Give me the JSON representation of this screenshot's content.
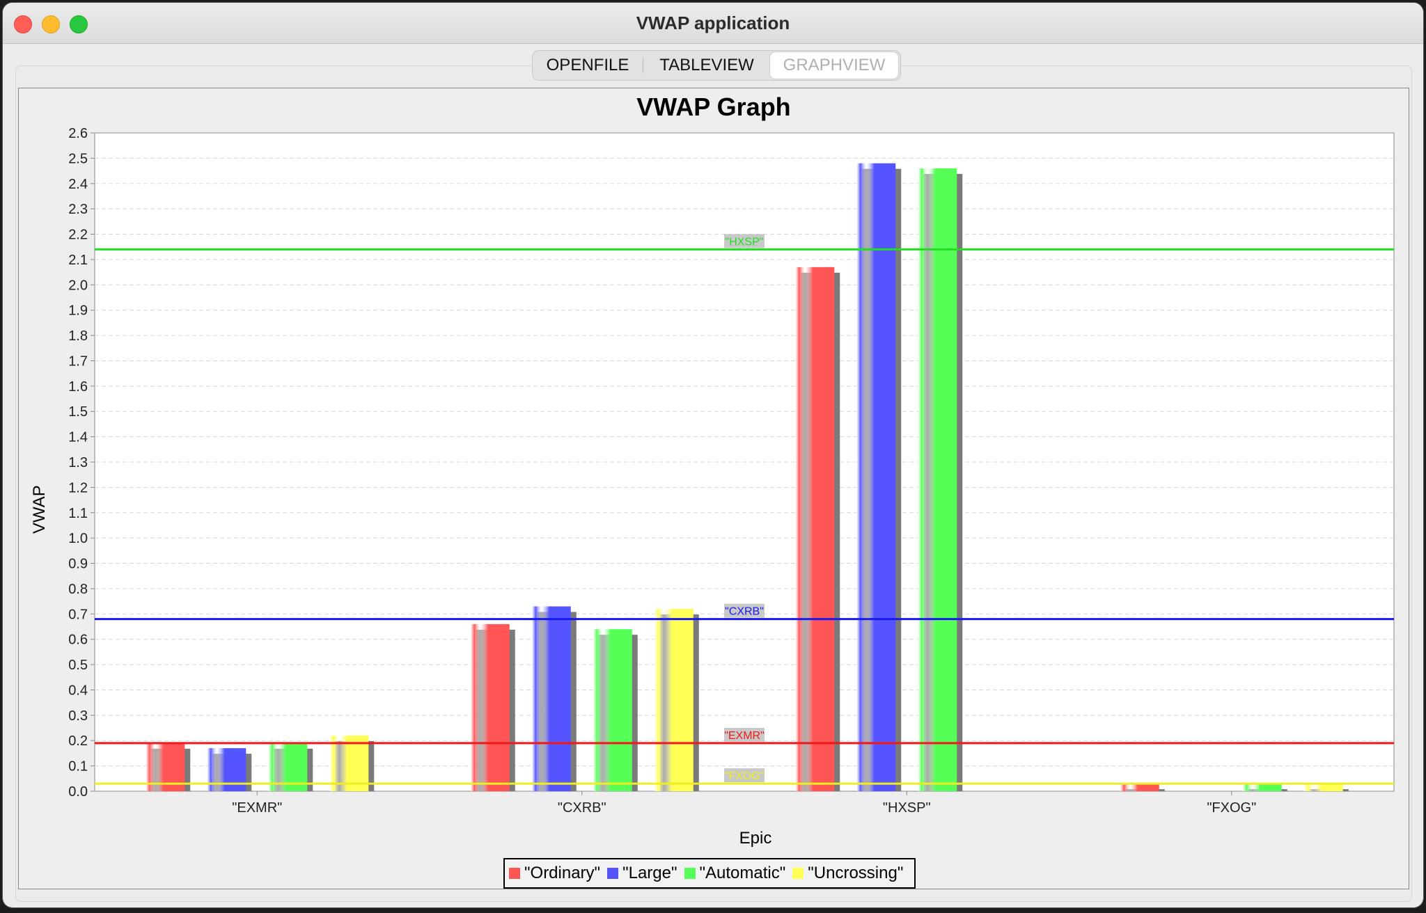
{
  "window": {
    "title": "VWAP application"
  },
  "tabs": [
    {
      "label": "OPENFILE"
    },
    {
      "label": "TABLEVIEW"
    },
    {
      "label": "GRAPHVIEW"
    }
  ],
  "colors": {
    "Ordinary": "#ff5555",
    "Large": "#5555ff",
    "Automatic": "#55ff55",
    "Uncrossing": "#ffff55"
  },
  "chart_data": {
    "type": "bar",
    "title": "VWAP Graph",
    "xlabel": "Epic",
    "ylabel": "VWAP",
    "ylim": [
      0,
      2.6
    ],
    "ytick_step": 0.1,
    "grid": true,
    "legend_position": "bottom-center",
    "categories": [
      "\"EXMR\"",
      "\"CXRB\"",
      "\"HXSP\"",
      "\"FXOG\""
    ],
    "series": [
      {
        "name": "\"Ordinary\"",
        "values": [
          0.19,
          0.66,
          2.07,
          0.03
        ]
      },
      {
        "name": "\"Large\"",
        "values": [
          0.17,
          0.73,
          2.48,
          0
        ]
      },
      {
        "name": "\"Automatic\"",
        "values": [
          0.19,
          0.64,
          2.46,
          0.03
        ]
      },
      {
        "name": "\"Uncrossing\"",
        "values": [
          0.22,
          0.72,
          0,
          0.03
        ]
      }
    ],
    "reference_lines": [
      {
        "label": "\"HXSP\"",
        "value": 2.14,
        "color": "#22dd22"
      },
      {
        "label": "\"CXRB\"",
        "value": 0.68,
        "color": "#1a1aee"
      },
      {
        "label": "\"EXMR\"",
        "value": 0.19,
        "color": "#ee1a1a"
      },
      {
        "label": "\"FXOG\"",
        "value": 0.03,
        "color": "#eeee22"
      }
    ]
  }
}
